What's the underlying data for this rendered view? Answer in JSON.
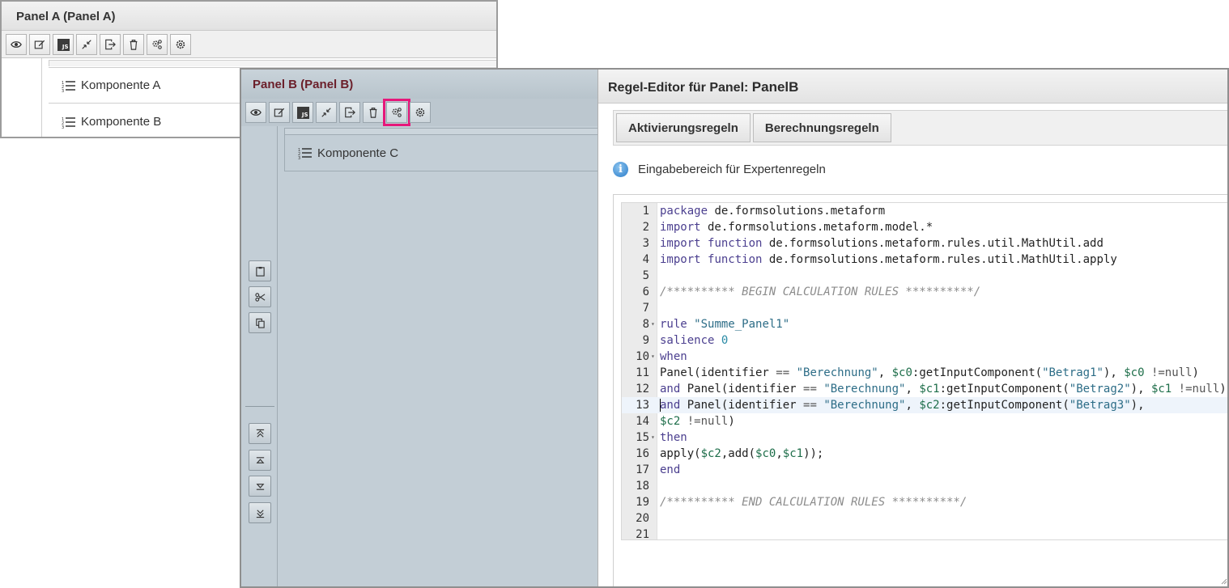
{
  "panel_a": {
    "title": "Panel A (Panel A)",
    "components": [
      "Komponente A",
      "Komponente B"
    ]
  },
  "panel_b": {
    "title": "Panel B (Panel B)",
    "components": [
      "Komponente C"
    ],
    "highlight_color": "#e6177a"
  },
  "toolbar_icons": [
    "eye-icon",
    "edit-icon",
    "js-icon",
    "collapse-icon",
    "export-icon",
    "trash-icon",
    "rules-icon",
    "settings-icon"
  ],
  "toolbar_js_label": "JS",
  "editor": {
    "title_prefix": "Regel-Editor für Panel: ",
    "panel_name": "PanelB",
    "tabs": [
      "Aktivierungsregeln",
      "Berechnungsregeln"
    ],
    "info_text": "Eingabebereich für Expertenregeln",
    "code_lines": [
      "package de.formsolutions.metaform",
      "import de.formsolutions.metaform.model.*",
      "import function de.formsolutions.metaform.rules.util.MathUtil.add",
      "import function de.formsolutions.metaform.rules.util.MathUtil.apply",
      "",
      "/********** BEGIN CALCULATION RULES **********/",
      "",
      "rule \"Summe_Panel1\"",
      "salience 0",
      "when",
      "Panel(identifier == \"Berechnung\", $c0:getInputComponent(\"Betrag1\"), $c0 !=null)",
      "and Panel(identifier == \"Berechnung\", $c1:getInputComponent(\"Betrag2\"), $c1 !=null)",
      "and Panel(identifier == \"Berechnung\", $c2:getInputComponent(\"Betrag3\"),",
      "$c2 !=null)",
      "then",
      "apply($c2,add($c0,$c1));",
      "end",
      "",
      "/********** END CALCULATION RULES **********/",
      "",
      ""
    ],
    "active_line": 13,
    "fold_lines": [
      8,
      10,
      15
    ]
  },
  "side_tools": [
    "clipboard-icon",
    "scissors-icon",
    "copy-icon",
    "move-top-icon",
    "move-up-icon",
    "move-down-icon",
    "move-bottom-icon"
  ]
}
